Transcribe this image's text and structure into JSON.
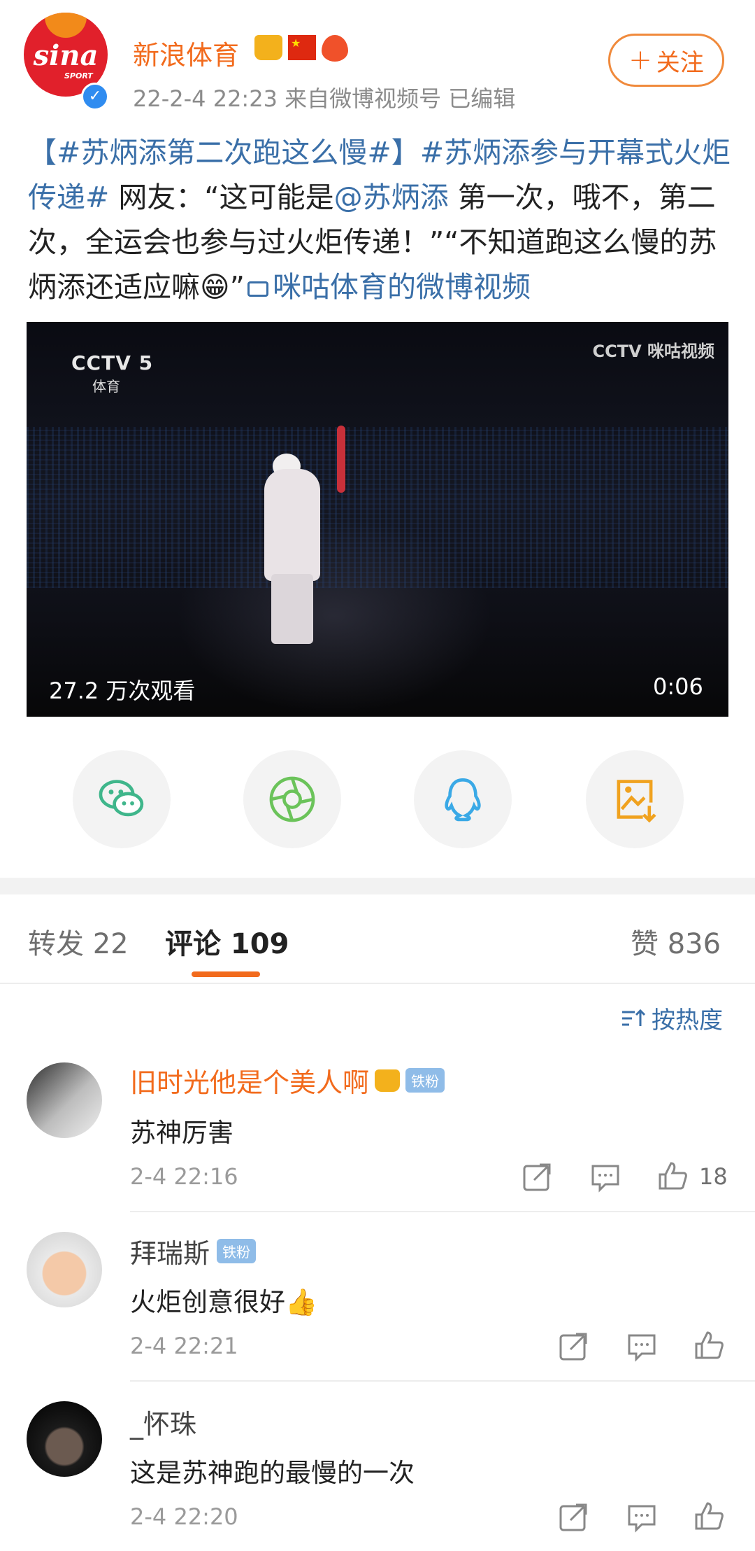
{
  "post": {
    "author": "新浪体育",
    "avatar_logo_text": "sina",
    "avatar_logo_sub": "SPORT",
    "meta": "22-2-4 22:23  来自微博视频号  已编辑",
    "follow_label": "关注",
    "text_parts": {
      "tag1": "【#苏炳添第二次跑这么慢#】",
      "tag2": "#苏炳添参与开幕式火炬传递#",
      "body1": " 网友：“这可能是",
      "mention": "@苏炳添",
      "body2": " 第一次，哦不，第二次，全运会也参与过火炬传递！”“不知道跑这么慢的苏炳添还适应嘛",
      "emoji": "😁",
      "body3": "”",
      "video_link": "咪咕体育的微博视频"
    },
    "video": {
      "views": "27.2 万次观看",
      "duration": "0:06",
      "overlay_left": "CCTV 5",
      "overlay_left_sub": "体育",
      "overlay_right": "CCTV 咪咕视频"
    }
  },
  "share_icons": [
    "wechat-icon",
    "moments-icon",
    "qq-icon",
    "save-image-icon"
  ],
  "tabs": {
    "repost": "转发 22",
    "comment": "评论 109",
    "like": "赞 836"
  },
  "sort_label": "按热度",
  "comments": [
    {
      "name": "旧时光他是个美人啊",
      "badge": "铁粉",
      "text": "苏神厉害",
      "time": "2-4 22:16",
      "likes": "18"
    },
    {
      "name": "拜瑞斯",
      "badge": "铁粉",
      "text": "火炬创意很好👍",
      "time": "2-4 22:21",
      "likes": ""
    },
    {
      "name": "_怀珠",
      "badge": "",
      "text": "这是苏神跑的最慢的一次",
      "time": "2-4 22:20",
      "likes": ""
    }
  ],
  "colors": {
    "accent": "#f26b1d",
    "link": "#3a6fa8",
    "wechat": "#3fb68b",
    "moments": "#6bc35a",
    "qq": "#3aa9e6",
    "save": "#f0a21f"
  }
}
